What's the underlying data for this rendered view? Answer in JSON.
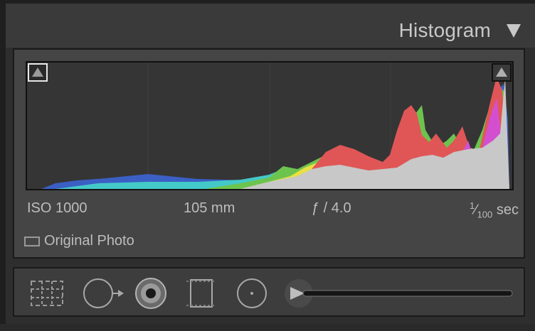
{
  "panel": {
    "title": "Histogram"
  },
  "exif": {
    "iso": "ISO 1000",
    "focal_length": "105 mm",
    "aperture": "ƒ / 4.0",
    "shutter_num": "1",
    "shutter_den": "100",
    "shutter_unit": "sec"
  },
  "original_photo": {
    "label": "Original Photo",
    "checked": false
  },
  "icons": {
    "collapse": "triangle-down-icon",
    "shadow_clip": "triangle-up-icon",
    "highlight_clip": "triangle-up-icon",
    "crop": "crop-overlay-icon",
    "spot_removal": "spot-removal-icon",
    "red_eye": "red-eye-icon",
    "graduated_filter": "graduated-filter-icon",
    "radial_filter": "radial-filter-icon",
    "adjustment_brush": "adjustment-brush-icon"
  },
  "colors": {
    "blue": "#3b5fc4",
    "cyan": "#44c9c9",
    "green": "#6cc44f",
    "yellow": "#e8e044",
    "red": "#e05656",
    "magenta": "#d44fd0",
    "luminance": "#c8c8c8"
  }
}
